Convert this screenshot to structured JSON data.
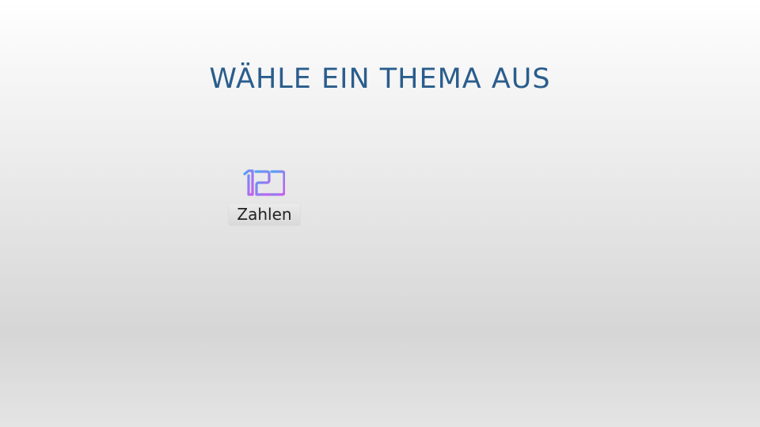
{
  "slide": {
    "title": "WÄHLE EIN THEMA AUS"
  },
  "topics": [
    {
      "label": "Zahlen",
      "icon": "numbers-123-icon"
    }
  ],
  "colors": {
    "title": "#2a5d8c",
    "icon_gradient_start": "#4fa3f5",
    "icon_gradient_end": "#c85cf0"
  }
}
